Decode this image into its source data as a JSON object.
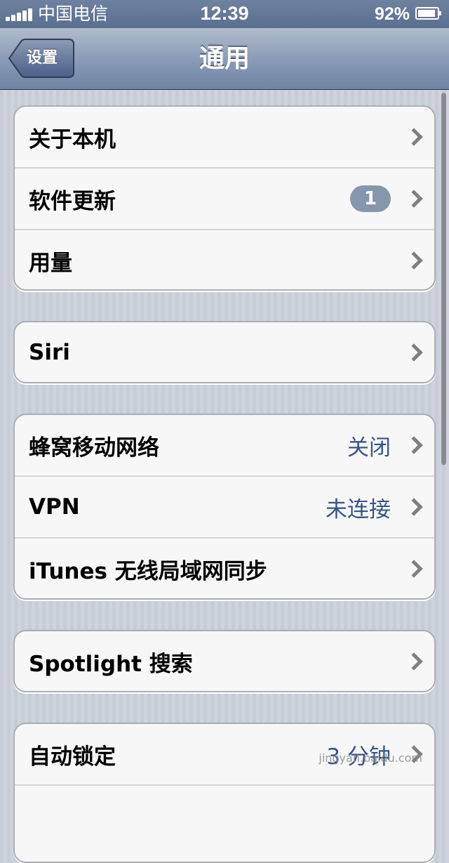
{
  "status_bar": {
    "carrier": "中国电信",
    "time": "12:39",
    "battery_percent": "92%",
    "battery_level": 0.92,
    "signal_bars": 5,
    "icons": [
      "signal-icon",
      "battery-icon"
    ]
  },
  "nav_bar": {
    "back_label": "设置",
    "title": "通用"
  },
  "groups": [
    {
      "rows": [
        {
          "label": "关于本机",
          "value": ""
        },
        {
          "label": "软件更新",
          "value": "",
          "badge": "1"
        },
        {
          "label": "用量",
          "value": ""
        }
      ]
    },
    {
      "rows": [
        {
          "label": "Siri",
          "value": ""
        }
      ]
    },
    {
      "rows": [
        {
          "label": "蜂窝移动网络",
          "value": "关闭"
        },
        {
          "label": "VPN",
          "value": "未连接"
        },
        {
          "label": "iTunes 无线局域网同步",
          "value": ""
        }
      ]
    },
    {
      "rows": [
        {
          "label": "Spotlight 搜索",
          "value": ""
        }
      ]
    },
    {
      "rows": [
        {
          "label": "自动锁定",
          "value": "3 分钟"
        },
        {
          "label": "",
          "value": ""
        }
      ]
    }
  ],
  "watermark": "jingyan.baidu.com",
  "colors": {
    "value_text": "#385487",
    "badge": "#8696ad",
    "nav_bar": "#8b9cb7"
  }
}
